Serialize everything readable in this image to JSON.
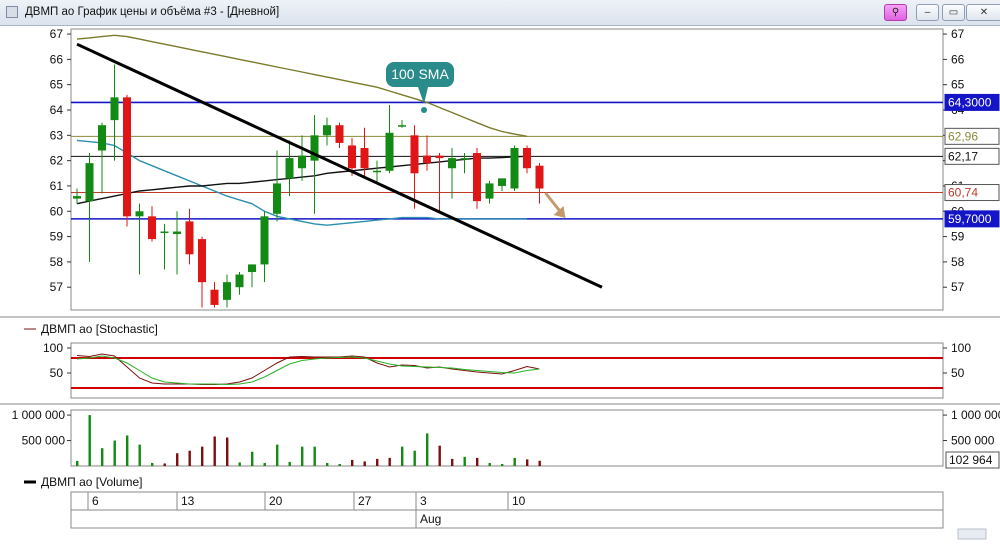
{
  "window": {
    "title": "ДВМП ао График цены и объёма #3 - [Дневной]",
    "buttons": {
      "pin": "⚲",
      "minimize": "–",
      "restore": "▭",
      "close": "✕"
    }
  },
  "chart_data": [
    {
      "type": "candlestick",
      "title": "",
      "ylim": [
        56.1,
        67.2
      ],
      "y_ticks": [
        "67",
        "66",
        "65",
        "64",
        "63",
        "62",
        "61",
        "60",
        "59",
        "58",
        "57"
      ],
      "x_ticks": [
        "6",
        "13",
        "20",
        "27",
        "3",
        "10"
      ],
      "x_sublabel": "Aug",
      "candles": [
        {
          "o": 60.5,
          "h": 60.9,
          "l": 60.3,
          "c": 60.6
        },
        {
          "o": 60.4,
          "h": 62.3,
          "l": 58.0,
          "c": 61.9
        },
        {
          "o": 62.4,
          "h": 63.5,
          "l": 60.7,
          "c": 63.4
        },
        {
          "o": 63.6,
          "h": 65.8,
          "l": 62.0,
          "c": 64.5
        },
        {
          "o": 64.5,
          "h": 64.6,
          "l": 59.4,
          "c": 59.8
        },
        {
          "o": 59.8,
          "h": 60.3,
          "l": 57.5,
          "c": 60.0
        },
        {
          "o": 59.8,
          "h": 60.2,
          "l": 58.8,
          "c": 58.9
        },
        {
          "o": 59.2,
          "h": 59.5,
          "l": 57.7,
          "c": 59.2
        },
        {
          "o": 59.1,
          "h": 60.0,
          "l": 57.5,
          "c": 59.2
        },
        {
          "o": 59.6,
          "h": 60.1,
          "l": 57.9,
          "c": 58.3
        },
        {
          "o": 58.9,
          "h": 59.0,
          "l": 56.2,
          "c": 57.2
        },
        {
          "o": 56.9,
          "h": 57.2,
          "l": 56.2,
          "c": 56.3
        },
        {
          "o": 56.5,
          "h": 57.5,
          "l": 56.2,
          "c": 57.2
        },
        {
          "o": 57.0,
          "h": 57.6,
          "l": 56.7,
          "c": 57.5
        },
        {
          "o": 57.6,
          "h": 57.9,
          "l": 57.0,
          "c": 57.9
        },
        {
          "o": 57.9,
          "h": 60.0,
          "l": 57.2,
          "c": 59.8
        },
        {
          "o": 59.9,
          "h": 62.4,
          "l": 59.6,
          "c": 61.1
        },
        {
          "o": 61.3,
          "h": 62.8,
          "l": 60.6,
          "c": 62.1
        },
        {
          "o": 61.7,
          "h": 63.0,
          "l": 61.2,
          "c": 62.2
        },
        {
          "o": 62.0,
          "h": 63.8,
          "l": 59.9,
          "c": 63.0
        },
        {
          "o": 63.0,
          "h": 63.7,
          "l": 62.6,
          "c": 63.4
        },
        {
          "o": 63.4,
          "h": 63.5,
          "l": 62.5,
          "c": 62.7
        },
        {
          "o": 62.6,
          "h": 62.9,
          "l": 61.4,
          "c": 61.7
        },
        {
          "o": 62.5,
          "h": 63.3,
          "l": 61.3,
          "c": 61.7
        },
        {
          "o": 61.6,
          "h": 62.0,
          "l": 61.1,
          "c": 61.6
        },
        {
          "o": 61.6,
          "h": 64.2,
          "l": 61.5,
          "c": 63.1
        },
        {
          "o": 63.4,
          "h": 63.6,
          "l": 63.3,
          "c": 63.4
        },
        {
          "o": 63.0,
          "h": 63.4,
          "l": 60.1,
          "c": 61.5
        },
        {
          "o": 62.2,
          "h": 63.0,
          "l": 61.6,
          "c": 61.9
        },
        {
          "o": 62.2,
          "h": 62.3,
          "l": 60.0,
          "c": 62.1
        },
        {
          "o": 61.7,
          "h": 62.5,
          "l": 60.5,
          "c": 62.1
        },
        {
          "o": 62.1,
          "h": 62.3,
          "l": 61.5,
          "c": 62.1
        },
        {
          "o": 62.3,
          "h": 62.5,
          "l": 60.1,
          "c": 60.4
        },
        {
          "o": 60.5,
          "h": 61.2,
          "l": 60.3,
          "c": 61.1
        },
        {
          "o": 61.0,
          "h": 61.3,
          "l": 60.8,
          "c": 61.3
        },
        {
          "o": 60.9,
          "h": 62.6,
          "l": 60.8,
          "c": 62.5
        },
        {
          "o": 62.5,
          "h": 62.6,
          "l": 61.5,
          "c": 61.7
        },
        {
          "o": 61.8,
          "h": 61.9,
          "l": 60.3,
          "c": 60.9
        }
      ],
      "sma_100": [
        66.8,
        66.85,
        66.9,
        66.95,
        66.9,
        66.8,
        66.7,
        66.6,
        66.5,
        66.4,
        66.3,
        66.2,
        66.1,
        66.0,
        65.9,
        65.8,
        65.7,
        65.6,
        65.5,
        65.4,
        65.3,
        65.2,
        65.1,
        65.0,
        64.9,
        64.75,
        64.6,
        64.45,
        64.3,
        64.1,
        63.9,
        63.7,
        63.5,
        63.3,
        63.15,
        63.05,
        62.96
      ],
      "sma_20": [
        62.8,
        62.75,
        62.7,
        62.6,
        62.3,
        62.0,
        61.8,
        61.6,
        61.4,
        61.2,
        61.0,
        60.8,
        60.6,
        60.45,
        60.3,
        60.0,
        59.8,
        59.7,
        59.6,
        59.5,
        59.45,
        59.5,
        59.55,
        59.6,
        59.65,
        59.7,
        59.75,
        59.75,
        59.75,
        59.7,
        59.7,
        59.7,
        59.7,
        59.7,
        59.7,
        59.7,
        59.7
      ],
      "sma_50": [
        60.3,
        60.4,
        60.5,
        60.6,
        60.7,
        60.8,
        60.85,
        60.9,
        60.95,
        61.0,
        61.0,
        61.05,
        61.1,
        61.1,
        61.15,
        61.2,
        61.25,
        61.3,
        61.35,
        61.4,
        61.5,
        61.55,
        61.6,
        61.65,
        61.7,
        61.75,
        61.8,
        61.85,
        61.9,
        61.95,
        62.0,
        62.05,
        62.1,
        62.1,
        62.12,
        62.15,
        62.17
      ],
      "trendline": {
        "start": [
          0,
          66.6
        ],
        "end": [
          42,
          57.0
        ]
      },
      "hlines": [
        {
          "value": 64.3,
          "label": "64,3000",
          "color": "#1515c8",
          "highlight": true
        },
        {
          "value": 62.96,
          "label": "62,96",
          "color": "#8a8a3a",
          "highlight": false
        },
        {
          "value": 62.17,
          "label": "62,17",
          "color": "#111111",
          "highlight": false
        },
        {
          "value": 60.74,
          "label": "60,74",
          "color": "#c0392b",
          "highlight": false
        },
        {
          "value": 59.7,
          "label": "59,7000",
          "color": "#1515c8",
          "highlight": true
        }
      ],
      "annotation": {
        "text": "100 SMA",
        "candle": 26
      },
      "colors": {
        "up": "#138a13",
        "down": "#e01616",
        "sma100": "#7a7a2a",
        "sma20": "#2a8fae",
        "sma50": "#111111",
        "trend": "#000000",
        "arrow": "#c49a6c"
      }
    },
    {
      "type": "line",
      "legend": "ДВМП ао [Stochastic]",
      "y_ticks": [
        "100",
        "50"
      ],
      "ylim": [
        0,
        110
      ],
      "levels": [
        80,
        20
      ],
      "series": [
        {
          "color": "#7a1010",
          "values": [
            85,
            83,
            88,
            84,
            62,
            40,
            30,
            28,
            28,
            28,
            27,
            27,
            28,
            32,
            40,
            55,
            70,
            82,
            83,
            82,
            82,
            82,
            84,
            82,
            70,
            62,
            66,
            65,
            60,
            62,
            58,
            55,
            52,
            50,
            48,
            55,
            63,
            58
          ]
        },
        {
          "color": "#27b327",
          "values": [
            78,
            80,
            84,
            80,
            70,
            55,
            40,
            32,
            30,
            28,
            28,
            28,
            27,
            28,
            32,
            42,
            55,
            68,
            75,
            78,
            80,
            81,
            82,
            80,
            74,
            68,
            64,
            63,
            62,
            61,
            60,
            57,
            55,
            53,
            51,
            50,
            55,
            58
          ]
        }
      ]
    },
    {
      "type": "bar",
      "legend": "ДВМП ао [Volume]",
      "y_ticks": [
        "1 000 000",
        "500 000"
      ],
      "ylim": [
        0,
        1100000
      ],
      "last_value": "102 964",
      "values": [
        100000,
        1000000,
        350000,
        500000,
        600000,
        420000,
        60000,
        50000,
        250000,
        300000,
        380000,
        580000,
        560000,
        70000,
        280000,
        60000,
        420000,
        80000,
        380000,
        380000,
        60000,
        40000,
        120000,
        90000,
        140000,
        160000,
        380000,
        300000,
        640000,
        400000,
        140000,
        180000,
        160000,
        60000,
        40000,
        160000,
        130000,
        102964
      ],
      "up": [
        true,
        true,
        true,
        true,
        true,
        true,
        true,
        false,
        false,
        false,
        false,
        false,
        false,
        true,
        true,
        true,
        true,
        true,
        true,
        true,
        true,
        true,
        false,
        false,
        false,
        false,
        true,
        true,
        true,
        false,
        false,
        true,
        false,
        true,
        true,
        true,
        false,
        false
      ],
      "colors": {
        "up": "#138a13",
        "down": "#7a1010"
      }
    }
  ]
}
